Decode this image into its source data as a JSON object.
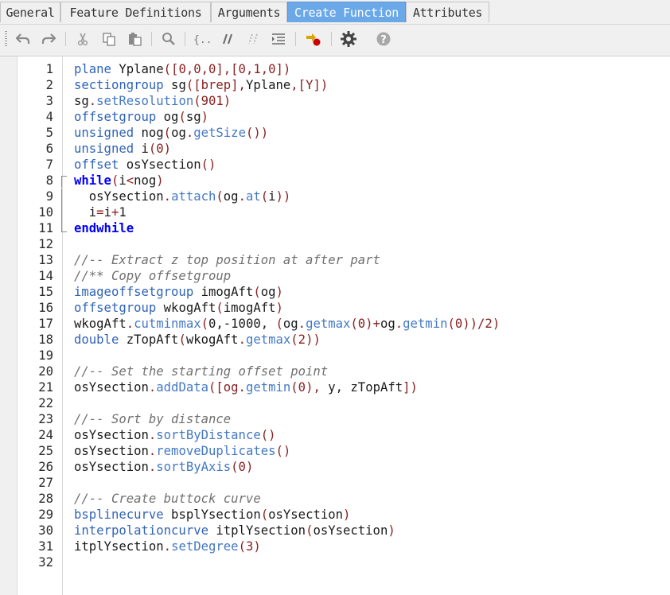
{
  "tabs": [
    "General",
    "Feature Definitions",
    "Arguments",
    "Create Function",
    "Attributes"
  ],
  "active_tab": "Create Function",
  "toolbar_icons": [
    "undo-icon",
    "redo-icon",
    "cut-icon",
    "copy-icon",
    "paste-icon",
    "find-icon",
    "braces-icon",
    "comment-icon",
    "uncomment-icon",
    "indent-icon",
    "run-icon",
    "settings-icon",
    "help-icon"
  ],
  "code": {
    "line_numbers": [
      "1",
      "2",
      "3",
      "4",
      "5",
      "6",
      "7",
      "8",
      "9",
      "10",
      "11",
      "12",
      "13",
      "14",
      "15",
      "16",
      "17",
      "18",
      "19",
      "20",
      "21",
      "22",
      "23",
      "24",
      "25",
      "26",
      "27",
      "28",
      "29",
      "30",
      "31",
      "32"
    ],
    "lines": [
      [
        [
          "kw",
          "plane"
        ],
        [
          "id",
          " Yplane"
        ],
        [
          "p",
          "([0,0,0],[0,1,0])"
        ]
      ],
      [
        [
          "kw",
          "sectiongroup"
        ],
        [
          "id",
          " sg"
        ],
        [
          "p",
          "([brep],"
        ],
        [
          "id",
          "Yplane"
        ],
        [
          "p",
          ",[Y])"
        ]
      ],
      [
        [
          "id",
          "sg"
        ],
        [
          "p",
          "."
        ],
        [
          "fn",
          "setResolution"
        ],
        [
          "p",
          "(901)"
        ]
      ],
      [
        [
          "kw",
          "offsetgroup"
        ],
        [
          "id",
          " og"
        ],
        [
          "p",
          "("
        ],
        [
          "id",
          "sg"
        ],
        [
          "p",
          ")"
        ]
      ],
      [
        [
          "kw",
          "unsigned"
        ],
        [
          "id",
          " nog"
        ],
        [
          "p",
          "("
        ],
        [
          "id",
          "og"
        ],
        [
          "p",
          "."
        ],
        [
          "fn",
          "getSize"
        ],
        [
          "p",
          "())"
        ]
      ],
      [
        [
          "kw",
          "unsigned"
        ],
        [
          "id",
          " i"
        ],
        [
          "p",
          "(0)"
        ]
      ],
      [
        [
          "kw",
          "offset"
        ],
        [
          "id",
          " osYsection"
        ],
        [
          "p",
          "()"
        ]
      ],
      [
        [
          "ctl",
          "while"
        ],
        [
          "p",
          "("
        ],
        [
          "id",
          "i"
        ],
        [
          "p",
          "<"
        ],
        [
          "id",
          "nog"
        ],
        [
          "p",
          ")"
        ]
      ],
      [
        [
          "id",
          "  osYsection"
        ],
        [
          "p",
          "."
        ],
        [
          "fn",
          "attach"
        ],
        [
          "p",
          "("
        ],
        [
          "id",
          "og"
        ],
        [
          "p",
          "."
        ],
        [
          "fn",
          "at"
        ],
        [
          "p",
          "("
        ],
        [
          "id",
          "i"
        ],
        [
          "p",
          "))"
        ]
      ],
      [
        [
          "id",
          "  i"
        ],
        [
          "p",
          "="
        ],
        [
          "id",
          "i"
        ],
        [
          "p",
          "+"
        ],
        [
          "id",
          "1"
        ]
      ],
      [
        [
          "ctl",
          "endwhile"
        ]
      ],
      [],
      [
        [
          "cm",
          "//-- Extract z top position at after part"
        ]
      ],
      [
        [
          "cm",
          "//** Copy offsetgroup"
        ]
      ],
      [
        [
          "kw",
          "imageoffsetgroup"
        ],
        [
          "id",
          " imogAft"
        ],
        [
          "p",
          "("
        ],
        [
          "id",
          "og"
        ],
        [
          "p",
          ")"
        ]
      ],
      [
        [
          "kw",
          "offsetgroup"
        ],
        [
          "id",
          " wkogAft"
        ],
        [
          "p",
          "("
        ],
        [
          "id",
          "imogAft"
        ],
        [
          "p",
          ")"
        ]
      ],
      [
        [
          "id",
          "wkogAft"
        ],
        [
          "p",
          "."
        ],
        [
          "fn",
          "cutminmax"
        ],
        [
          "p",
          "("
        ],
        [
          "id",
          "0,-1000, "
        ],
        [
          "p",
          "("
        ],
        [
          "id",
          "og"
        ],
        [
          "p",
          "."
        ],
        [
          "fn",
          "getmax"
        ],
        [
          "p",
          "(0)+"
        ],
        [
          "id",
          "og"
        ],
        [
          "p",
          "."
        ],
        [
          "fn",
          "getmin"
        ],
        [
          "p",
          "(0))/2)"
        ]
      ],
      [
        [
          "kw",
          "double"
        ],
        [
          "id",
          " zTopAft"
        ],
        [
          "p",
          "("
        ],
        [
          "id",
          "wkogAft"
        ],
        [
          "p",
          "."
        ],
        [
          "fn",
          "getmax"
        ],
        [
          "p",
          "(2))"
        ]
      ],
      [],
      [
        [
          "cm",
          "//-- Set the starting offset point"
        ]
      ],
      [
        [
          "id",
          "osYsection"
        ],
        [
          "p",
          "."
        ],
        [
          "fn",
          "addData"
        ],
        [
          "p",
          "([og."
        ],
        [
          "fn",
          "getmin"
        ],
        [
          "p",
          "(0), "
        ],
        [
          "id",
          "y, zTopAft"
        ],
        [
          "p",
          "])"
        ]
      ],
      [],
      [
        [
          "cm",
          "//-- Sort by distance"
        ]
      ],
      [
        [
          "id",
          "osYsection"
        ],
        [
          "p",
          "."
        ],
        [
          "fn",
          "sortByDistance"
        ],
        [
          "p",
          "()"
        ]
      ],
      [
        [
          "id",
          "osYsection"
        ],
        [
          "p",
          "."
        ],
        [
          "fn",
          "removeDuplicates"
        ],
        [
          "p",
          "()"
        ]
      ],
      [
        [
          "id",
          "osYsection"
        ],
        [
          "p",
          "."
        ],
        [
          "fn",
          "sortByAxis"
        ],
        [
          "p",
          "(0)"
        ]
      ],
      [],
      [
        [
          "cm",
          "//-- Create buttock curve"
        ]
      ],
      [
        [
          "kw",
          "bsplinecurve"
        ],
        [
          "id",
          " bsplYsection"
        ],
        [
          "p",
          "("
        ],
        [
          "id",
          "osYsection"
        ],
        [
          "p",
          ")"
        ]
      ],
      [
        [
          "kw",
          "interpolationcurve"
        ],
        [
          "id",
          " itplYsection"
        ],
        [
          "p",
          "("
        ],
        [
          "id",
          "osYsection"
        ],
        [
          "p",
          ")"
        ]
      ],
      [
        [
          "id",
          "itplYsection"
        ],
        [
          "p",
          "."
        ],
        [
          "fn",
          "setDegree"
        ],
        [
          "p",
          "(3)"
        ]
      ],
      []
    ]
  }
}
